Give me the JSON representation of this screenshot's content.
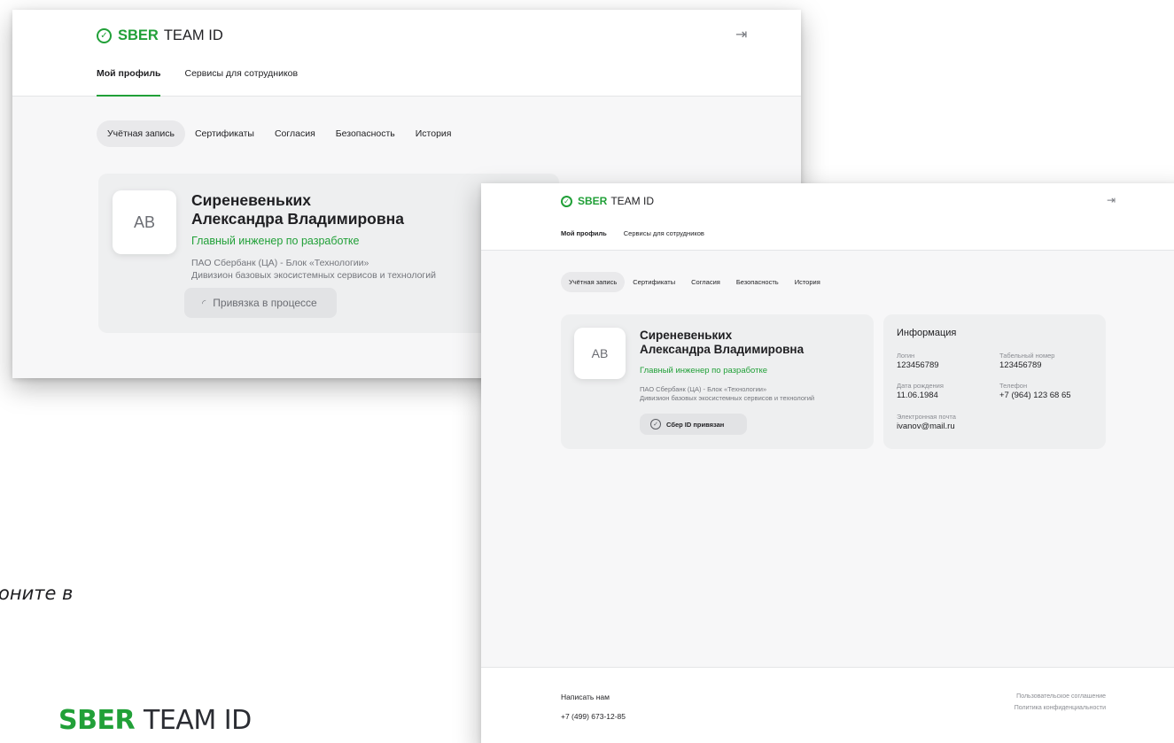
{
  "background": {
    "partial_text": "оните в",
    "brand_sber": "SBER",
    "brand_team": "TEAM ID"
  },
  "app": {
    "logo_sber": "SBER",
    "logo_team": "TEAM ID"
  },
  "nav": {
    "profile": "Мой профиль",
    "services": "Сервисы для сотрудников"
  },
  "tabs": {
    "account": "Учётная запись",
    "certificates": "Сертификаты",
    "consents": "Согласия",
    "security": "Безопасность",
    "history": "История"
  },
  "profile": {
    "initials": "АВ",
    "surname": "Сиреневеньких",
    "given_names": "Александра Владимировна",
    "role": "Главный инженер по разработке",
    "org_line1": "ПАО Сбербанк (ЦА) - Блок «Технологии»",
    "org_line2": "Дивизион базовых экосистемных сервисов и технологий"
  },
  "window1": {
    "status": "Привязка в процессе"
  },
  "window2": {
    "status": "Сбер ID привязан",
    "info": {
      "title": "Информация",
      "login_label": "Логин",
      "login_value": "123456789",
      "tabnum_label": "Табельный номер",
      "tabnum_value": "123456789",
      "birth_label": "Дата рождения",
      "birth_value": "11.06.1984",
      "phone_label": "Телефон",
      "phone_value": "+7 (964) 123 68 65",
      "email_label": "Электронная почта",
      "email_value": "ivanov@mail.ru"
    },
    "footer": {
      "write_us": "Написать нам",
      "phone": "+7 (499) 673-12-85",
      "agreement": "Пользовательское соглашение",
      "privacy": "Политика конфиденциальности"
    }
  },
  "colors": {
    "accent": "#21a038",
    "card_bg": "#eeeff0",
    "content_bg": "#f7f7f8"
  }
}
